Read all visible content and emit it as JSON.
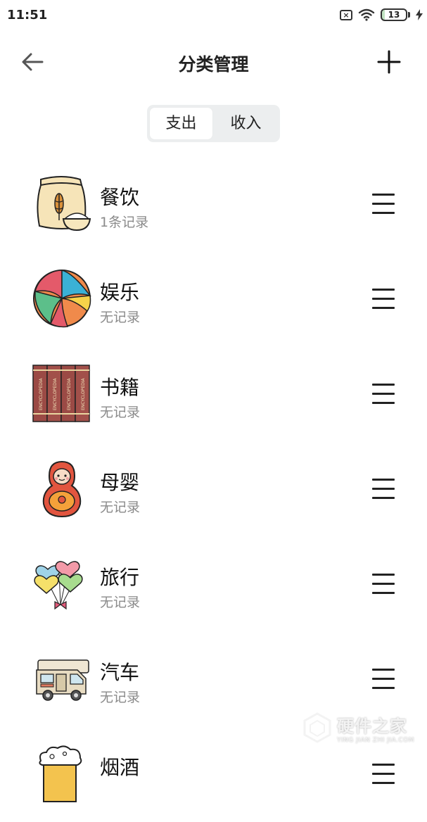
{
  "status_bar": {
    "time": "11:51",
    "battery_level": "13",
    "sim_icon": "sim-disabled-icon",
    "wifi_icon": "wifi-icon",
    "charging_icon": "bolt-icon"
  },
  "header": {
    "title": "分类管理",
    "back_icon": "arrow-left-icon",
    "add_icon": "plus-icon"
  },
  "segment": {
    "tabs": [
      {
        "label": "支出",
        "active": true
      },
      {
        "label": "收入",
        "active": false
      }
    ]
  },
  "categories": [
    {
      "name": "餐饮",
      "subtitle": "1条记录",
      "icon": "grain-sack-icon"
    },
    {
      "name": "娱乐",
      "subtitle": "无记录",
      "icon": "beach-ball-icon"
    },
    {
      "name": "书籍",
      "subtitle": "无记录",
      "icon": "encyclopedia-books-icon",
      "icon_text": "ENCYCLOPEDIA"
    },
    {
      "name": "母婴",
      "subtitle": "无记录",
      "icon": "matryoshka-doll-icon"
    },
    {
      "name": "旅行",
      "subtitle": "无记录",
      "icon": "heart-balloons-icon"
    },
    {
      "name": "汽车",
      "subtitle": "无记录",
      "icon": "camper-van-icon"
    },
    {
      "name": "烟酒",
      "subtitle": "",
      "icon": "beer-mug-icon"
    }
  ],
  "watermark": {
    "title": "硬件之家",
    "subtitle": "YING JIAN ZHI JIA.COM"
  },
  "colors": {
    "accent_text": "#111111",
    "subtitle": "#8a8a8a",
    "segment_bg": "#eceeef"
  }
}
